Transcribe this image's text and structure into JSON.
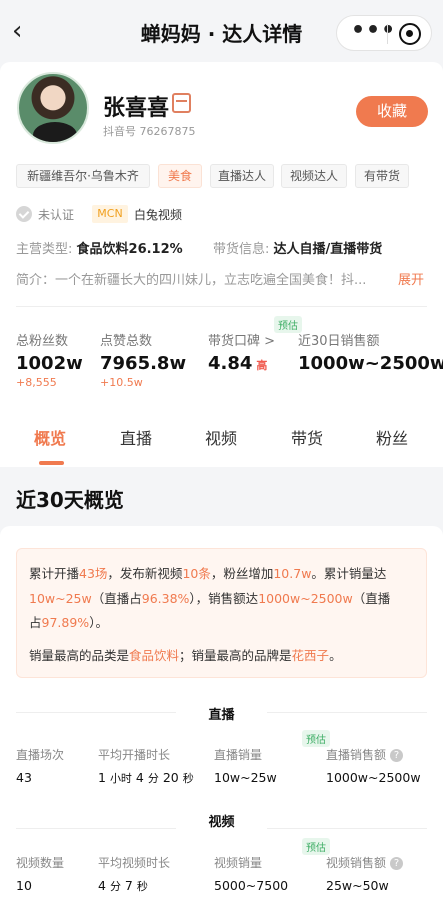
{
  "header": {
    "title": "蝉妈妈 · 达人详情",
    "back_icon": "chevron-left-icon",
    "more_icon": "more-dots-icon",
    "close_icon": "target-icon"
  },
  "profile": {
    "name": "张喜喜",
    "douyin_id": "抖音号 76267875",
    "collect_label": "收藏",
    "tags": [
      "新疆维吾尔·乌鲁木齐",
      "美食",
      "直播达人",
      "视频达人",
      "有带货"
    ],
    "cert_status": "未认证",
    "mcn_label": "MCN",
    "mcn_name": "白兔视频",
    "main_category_key": "主营类型:",
    "main_category_value": "食品饮料26.12%",
    "sales_info_key": "带货信息:",
    "sales_info_value": "达人自播/直播带货",
    "intro": "简介：一个在新疆长大的四川妹儿，立志吃遍全国美食！抖...",
    "expand_label": "展开"
  },
  "stats": [
    {
      "label": "总粉丝数",
      "value": "1002w",
      "inc": "+8,555"
    },
    {
      "label": "点赞总数",
      "value": "7965.8w",
      "inc": "+10.5w"
    },
    {
      "label": "带货口碑 >",
      "value": "4.84",
      "level": "高",
      "badge": "预估"
    },
    {
      "label": "近30日销售额",
      "value": "1000w~2500w"
    }
  ],
  "tabs": [
    "概览",
    "直播",
    "视频",
    "带货",
    "粉丝"
  ],
  "section_title": "近30天概览",
  "summary": {
    "l1": [
      "累计开播",
      "43场",
      "，发布新视频",
      "10条",
      "，粉丝增加",
      "10.7w",
      "。累计销量达"
    ],
    "l2": [
      "10w~25w",
      "（直播占",
      "96.38%",
      "），销售额达",
      "1000w~2500w",
      "（直播"
    ],
    "l3": [
      "占",
      "97.89%",
      "）。"
    ],
    "l4": [
      "销量最高的品类是",
      "食品饮料",
      "；销量最高的品牌是",
      "花西子",
      "。"
    ]
  },
  "live": {
    "title": "直播",
    "badge": "预估",
    "cells": [
      {
        "label": "直播场次",
        "value": "43"
      },
      {
        "label": "平均开播时长",
        "v1": "1",
        "u1": "小时",
        "v2": "4",
        "u2": "分",
        "v3": "20",
        "u3": "秒"
      },
      {
        "label": "直播销量",
        "value": "10w~25w"
      },
      {
        "label": "直播销售额",
        "value": "1000w~2500w"
      }
    ]
  },
  "video": {
    "title": "视频",
    "badge": "预估",
    "cells": [
      {
        "label": "视频数量",
        "value": "10"
      },
      {
        "label": "平均视频时长",
        "v1": "4",
        "u1": "分",
        "v2": "7",
        "u2": "秒"
      },
      {
        "label": "视频销量",
        "value": "5000~7500"
      },
      {
        "label": "视频销售额",
        "value": "25w~50w"
      }
    ]
  },
  "colors": {
    "accent": "#f07a4f",
    "estimate": "#3fae66"
  }
}
